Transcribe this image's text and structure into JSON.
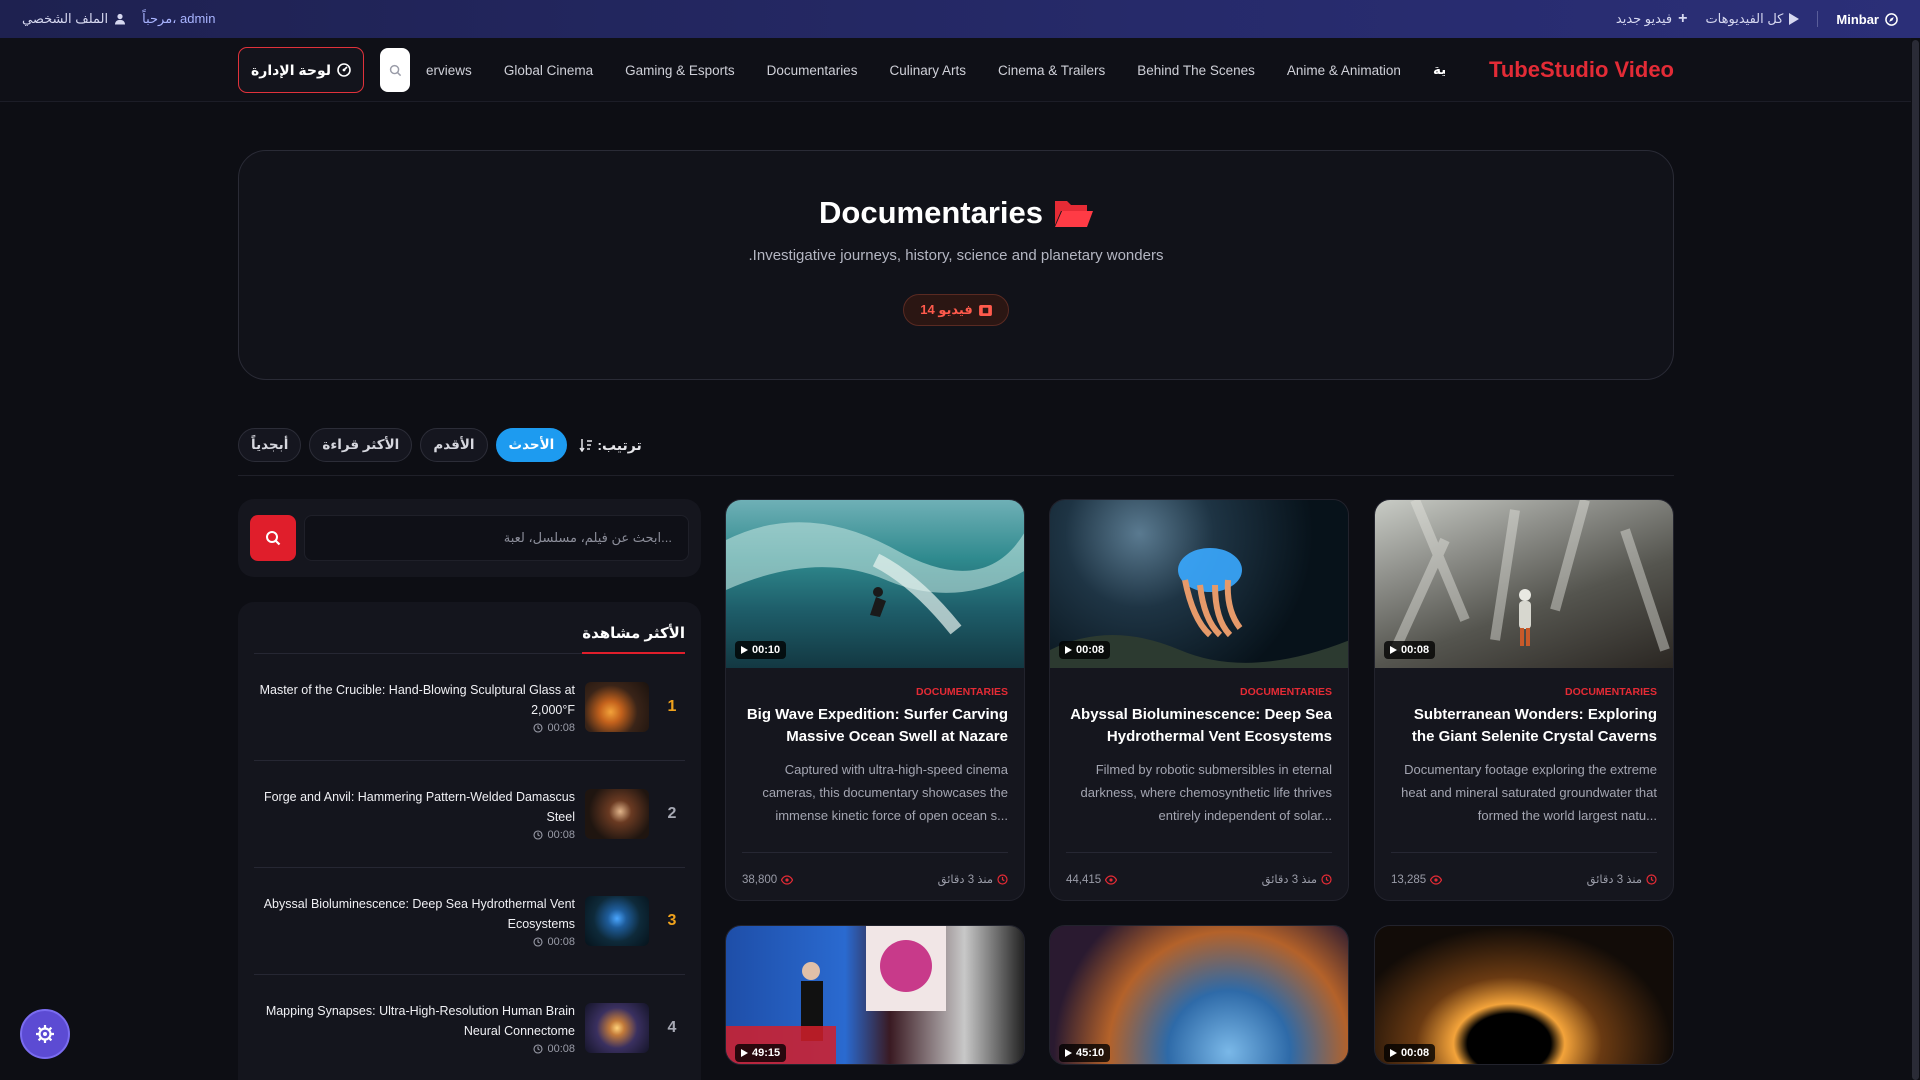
{
  "topbar": {
    "brand": "Minbar",
    "all_videos": "كل الفيديوهات",
    "new_video": "فيديو جديد",
    "welcome": "مرحباً، admin",
    "profile": "الملف الشخصي"
  },
  "nav": {
    "logo": "TubeStudio Video",
    "home": "الرئيسية",
    "links": [
      "Anime & Animation",
      "Behind The Scenes",
      "Cinema & Trailers",
      "Culinary Arts",
      "Documentaries",
      "Gaming & Esports",
      "Global Cinema",
      "erviews"
    ],
    "admin_label": "لوحة الإدارة"
  },
  "hero": {
    "title": "Documentaries",
    "description": ".Investigative journeys, history, science and planetary wonders",
    "badge": "14 فيديو"
  },
  "sort": {
    "label": "ترتيب:",
    "options": [
      "الأحدث",
      "الأقدم",
      "الأكثر قراءة",
      "أبجدياً"
    ],
    "active": "الأحدث"
  },
  "search": {
    "placeholder": "ابحث عن فيلم، مسلسل، لعبة..."
  },
  "popular": {
    "heading": "الأكثر مشاهدة",
    "items": [
      {
        "rank": "1",
        "title": "Master of the Crucible: Hand-Blowing Sculptural Glass at 2,000°F",
        "duration": "00:08"
      },
      {
        "rank": "2",
        "title": "Forge and Anvil: Hammering Pattern-Welded Damascus Steel",
        "duration": "00:08"
      },
      {
        "rank": "3",
        "title": "Abyssal Bioluminescence: Deep Sea Hydrothermal Vent Ecosystems",
        "duration": "00:08"
      },
      {
        "rank": "4",
        "title": "Mapping Synapses: Ultra-High-Resolution Human Brain Neural Connectome",
        "duration": "00:08"
      }
    ]
  },
  "cards": [
    {
      "category": "DOCUMENTARIES",
      "title": "Subterranean Wonders: Exploring the Giant Selenite Crystal Caverns",
      "description": "Documentary footage exploring the extreme heat and mineral saturated groundwater that formed the world largest natu...",
      "duration": "00:08",
      "time": "منذ 3 دقائق",
      "views": "13,285"
    },
    {
      "category": "DOCUMENTARIES",
      "title": "Abyssal Bioluminescence: Deep Sea Hydrothermal Vent Ecosystems",
      "description": "Filmed by robotic submersibles in eternal darkness, where chemosynthetic life thrives entirely independent of solar...",
      "duration": "00:08",
      "time": "منذ 3 دقائق",
      "views": "44,415"
    },
    {
      "category": "DOCUMENTARIES",
      "title": "Big Wave Expedition: Surfer Carving Massive Ocean Swell at Nazare",
      "description": "Captured with ultra-high-speed cinema cameras, this documentary showcases the immense kinetic force of open ocean s...",
      "duration": "00:10",
      "time": "منذ 3 دقائق",
      "views": "38,800"
    },
    {
      "duration": "00:08"
    },
    {
      "duration": "45:10"
    },
    {
      "duration": "49:15"
    }
  ],
  "colors": {
    "accent": "#e01e2b",
    "active_sort": "#1d9bf0",
    "rank_gold": "#f0a21c",
    "settings_button": "#5c4bd3"
  }
}
